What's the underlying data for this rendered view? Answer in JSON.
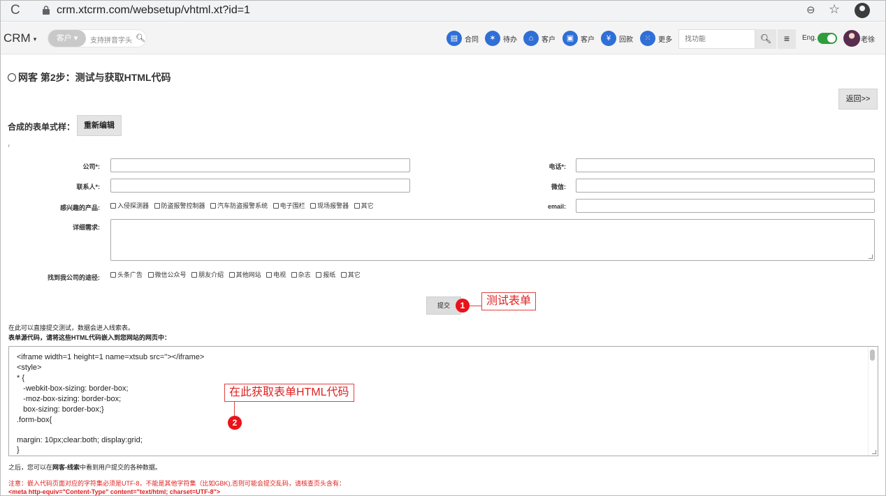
{
  "browser": {
    "url": "crm.xtcrm.com/websetup/vhtml.xt?id=1",
    "reload_glyph": "C",
    "zoom_glyph": "⊖",
    "star_glyph": "☆"
  },
  "header": {
    "logo": "CRM",
    "logo_caret": "▾",
    "search": {
      "type_label": "客户 ▾",
      "placeholder": "支持拼音字头",
      "search_glyph": "🔍︎"
    },
    "quick_links": [
      {
        "icon": "contract-icon",
        "glyph": "▤",
        "label": "合同"
      },
      {
        "icon": "todo-icon",
        "glyph": "✶",
        "label": "待办"
      },
      {
        "icon": "bank-icon",
        "glyph": "⌂",
        "label": "客户"
      },
      {
        "icon": "customer-card-icon",
        "glyph": "▣",
        "label": "客户"
      },
      {
        "icon": "yen-icon",
        "glyph": "¥",
        "label": "回款"
      },
      {
        "icon": "grid-icon",
        "glyph": "⁙",
        "label": "更多"
      }
    ],
    "function_search_placeholder": "找功能",
    "function_search_glyph": "🔍︎",
    "menu_glyph": "≡",
    "lang_label": "Eng.",
    "lang_toggle_on": true,
    "user_name": "老徐",
    "accent_color": "#2f6fd6"
  },
  "page": {
    "title": "网客 第2步：测试与获取HTML代码",
    "back_label": "返回>>",
    "sample_label": "合成的表单式样：",
    "reedit_label": "重新编辑",
    "tiny_mark": "r"
  },
  "form": {
    "company_label": "公司*:",
    "phone_label": "电话*:",
    "contact_label": "联系人*:",
    "wechat_label": "微信:",
    "products_label": "感兴趣的产品:",
    "email_label": "email:",
    "products": [
      "入侵探测器",
      "防盗报警控制器",
      "汽车防盗报警系统",
      "电子围栏",
      "现场报警器",
      "其它"
    ],
    "detail_label": "详细需求:",
    "source_label": "找到我公司的途径:",
    "sources": [
      "头条广告",
      "微信公众号",
      "朋友介绍",
      "其他网站",
      "电视",
      "杂志",
      "报纸",
      "其它"
    ],
    "submit_label": "提交"
  },
  "annotations": {
    "badge_1": "1",
    "callout_1": "测试表单",
    "badge_2": "2",
    "callout_2": "在此获取表单HTML代码",
    "color": "#e8131b"
  },
  "info": {
    "line1": "在此可以直接提交测试，数据会进入线索表。",
    "line2": "表单源代码，请将这些HTML代码嵌入到您网站的网页中："
  },
  "code_lines": [
    "<iframe width=1 height=1 name=xtsub src=''></iframe>",
    "<style>",
    "* {",
    "   -webkit-box-sizing: border-box;",
    "   -moz-box-sizing: border-box;",
    "   box-sizing: border-box;}",
    ".form-box{",
    "",
    "margin: 10px;clear:both; display:grid;",
    "}"
  ],
  "footer": {
    "after_prefix": "之后，您可以在",
    "after_bold": "网客-线索",
    "after_suffix": "中看到用户提交的各种数据。",
    "note1": "注意：嵌入代码页面对应的字符集必须是UTF-8，不能是其他字符集（比如GBK),否则可能会提交乱码，请核查页头含有：",
    "note2": "<meta http-equiv=\"Content-Type\" content=\"text/html; charset=UTF-8\">"
  }
}
